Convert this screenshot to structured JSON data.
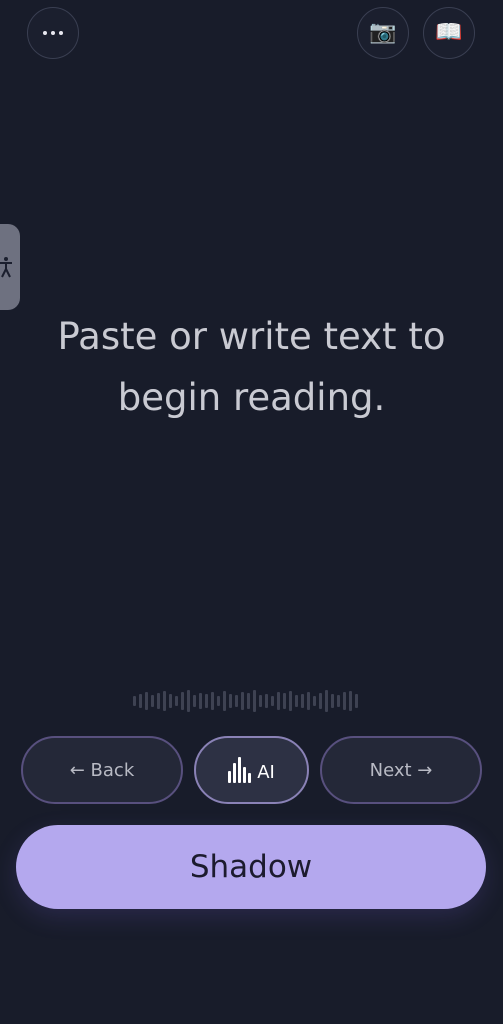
{
  "toolbar": {
    "more_icon": "more-horizontal-icon",
    "camera_icon": "camera-icon",
    "book_icon": "book-icon",
    "camera_glyph": "📷",
    "book_glyph": "📖"
  },
  "accessibility_tab": {
    "icon": "accessibility-icon",
    "glyph": "🯅"
  },
  "prompt": {
    "line1": "Paste or write text to",
    "line2": "begin reading."
  },
  "controls": {
    "back_label": "← Back",
    "ai_label": "AI",
    "next_label": "Next →",
    "shadow_label": "Shadow"
  },
  "colors": {
    "background": "#181c2a",
    "accent": "#b4a8ee",
    "pill_border": "#58507e"
  }
}
